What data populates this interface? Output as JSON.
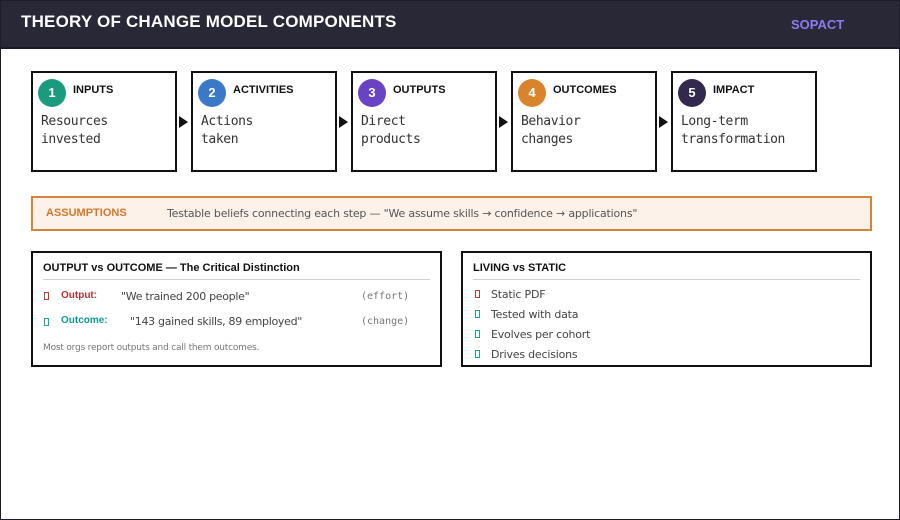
{
  "header": {
    "title": "THEORY OF CHANGE MODEL COMPONENTS",
    "brand": "SOPACT"
  },
  "steps": [
    {
      "num": "1",
      "title": "INPUTS",
      "desc_line1": "Resources",
      "desc_line2": "invested",
      "color": "#1a9a7e"
    },
    {
      "num": "2",
      "title": "ACTIVITIES",
      "desc_line1": "Actions",
      "desc_line2": "taken",
      "color": "#3a78c8"
    },
    {
      "num": "3",
      "title": "OUTPUTS",
      "desc_line1": "Direct",
      "desc_line2": "products",
      "color": "#6a42c4"
    },
    {
      "num": "4",
      "title": "OUTCOMES",
      "desc_line1": "Behavior",
      "desc_line2": "changes",
      "color": "#d8842c"
    },
    {
      "num": "5",
      "title": "IMPACT",
      "desc_line1": "Long-term",
      "desc_line2": "transformation",
      "color": "#33294f"
    }
  ],
  "assumptions": {
    "label": "ASSUMPTIONS",
    "text": "Testable beliefs connecting each step  —  \"We assume skills → confidence → applications\""
  },
  "distinction": {
    "title": "OUTPUT vs OUTCOME — The Critical Distinction",
    "output_label": "Output:",
    "output_quote": "\"We trained 200 people\"",
    "output_tag": "(effort)",
    "outcome_label": "Outcome:",
    "outcome_quote": "\"143 gained skills, 89 employed\"",
    "outcome_tag": "(change)",
    "note": "Most orgs report outputs and call them outcomes."
  },
  "living": {
    "title": "LIVING vs STATIC",
    "items": [
      {
        "text": "Static PDF",
        "status": "red"
      },
      {
        "text": "Tested with data",
        "status": "teal"
      },
      {
        "text": "Evolves per cohort",
        "status": "teal"
      },
      {
        "text": "Drives decisions",
        "status": "teal"
      }
    ]
  },
  "colors": {
    "header_bg": "#282836",
    "brand": "#8a7cf0",
    "assumption_border": "#d8833a",
    "assumption_bg": "#fdf2ea",
    "negative": "#c0392b",
    "positive": "#17a2a0"
  }
}
